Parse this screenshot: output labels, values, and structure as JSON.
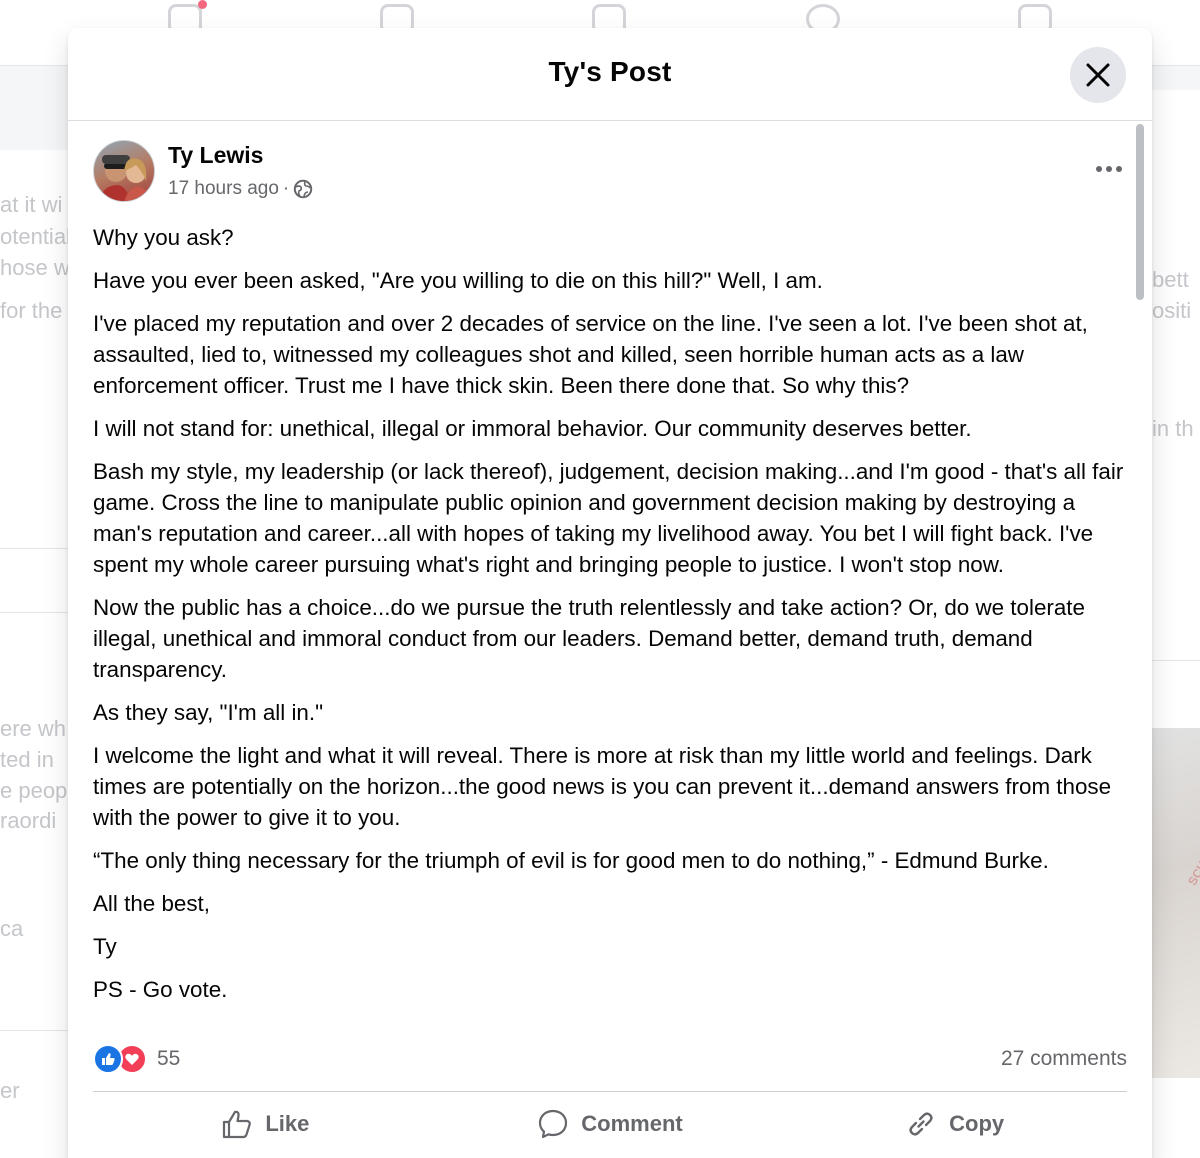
{
  "colors": {
    "accent": "#1b74e4",
    "love": "#f33e58",
    "secondary_text": "#65676b",
    "modal_bg": "#ffffff"
  },
  "background": {
    "left_fragments": [
      "at it wi",
      "otential",
      "hose w",
      "for the",
      "ere wh",
      "ted in",
      "e peopl",
      "raordi",
      "ca",
      "er"
    ],
    "right_fragments": [
      "bett",
      "ositi",
      "in th"
    ],
    "image_label": "SCHOOL FUNDR CERT"
  },
  "modal": {
    "title": "Ty's Post",
    "close_icon": "close-icon"
  },
  "post": {
    "author": "Ty Lewis",
    "timestamp": "17 hours ago",
    "separator": "·",
    "privacy_icon": "globe-icon",
    "paragraphs": [
      "Why you ask?",
      "Have you ever been asked, \"Are you willing to die on this hill?\"  Well, I am.",
      "I've placed my reputation and over 2 decades of service on the line.  I've seen a lot.  I've been shot at, assaulted, lied to, witnessed my colleagues shot and killed, seen horrible human acts as a law enforcement officer.  Trust me I have thick skin.  Been there done that.  So why this?",
      "I will not stand for: unethical, illegal or immoral behavior.  Our community deserves better.",
      "Bash my style, my leadership (or lack thereof), judgement, decision making...and I'm good - that's all fair game.  Cross the line to manipulate public opinion and government decision making by destroying a man's reputation and career...all with hopes of taking my livelihood away.  You bet I will fight back.  I've spent my whole career pursuing what's right and bringing people to justice.  I won't stop now.",
      "Now the public has a choice...do we pursue the truth relentlessly and take action?  Or, do we tolerate illegal, unethical and immoral conduct from our leaders.  Demand better, demand truth, demand transparency.",
      "As they say, \"I'm all in.\"",
      "I welcome the light and what it will reveal.  There is more at risk than my little world and feelings.  Dark times are potentially on the horizon...the good news is you can prevent it...demand answers from those with the power to give it to you.",
      "“The only thing necessary for the triumph of evil is for good men to do nothing,” - Edmund Burke.",
      "All the best,",
      "Ty",
      "PS - Go vote."
    ],
    "reaction_count": "55",
    "comments_count": "27 comments"
  },
  "actions": {
    "like": "Like",
    "comment": "Comment",
    "copy": "Copy"
  }
}
